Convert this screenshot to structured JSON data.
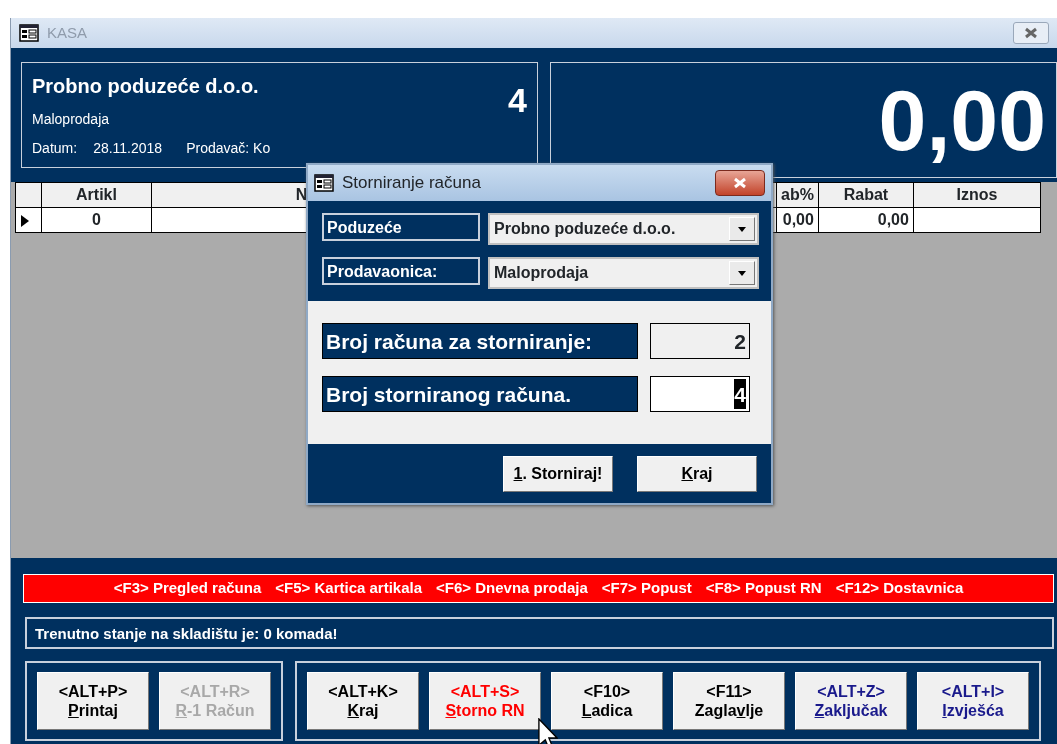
{
  "window": {
    "title": "KASA",
    "active": false
  },
  "header": {
    "company": "Probno poduzeće d.o.o.",
    "store": "Maloprodaja",
    "date_label": "Datum:",
    "date": "28.11.2018",
    "seller": "Prodavač: Ko",
    "receipt_number": "4",
    "total": "0,00"
  },
  "table": {
    "columns": [
      "Artikl",
      "N",
      "ab%",
      "Rabat",
      "Iznos"
    ],
    "rows": [
      {
        "current": true,
        "cells": [
          "0",
          null,
          "0,00",
          "0,00",
          null
        ]
      }
    ]
  },
  "function_keys": [
    "<F3> Pregled računa",
    "<F5> Kartica artikala",
    "<F6> Dnevna prodaja",
    "<F7> Popust",
    "<F8> Popust RN",
    "<F12> Dostavnica"
  ],
  "status": "Trenutno stanje na skladištu je: 0 komada!",
  "button_groups": [
    [
      {
        "hotkey": "<ALT+P>",
        "label": {
          "key": "P",
          "after": "rintaj"
        },
        "color": "#000000",
        "disabled": false
      },
      {
        "hotkey": "<ALT+R>",
        "label": {
          "key": "R",
          "after": "-1 Račun"
        },
        "disabled": true
      }
    ],
    [
      {
        "hotkey": "<ALT+K>",
        "label": {
          "key": "K",
          "after": "raj"
        },
        "color": "#000000",
        "disabled": false
      },
      {
        "hotkey": "<ALT+S>",
        "label": {
          "key": "S",
          "after": "torno RN"
        },
        "color": "#ff0000",
        "disabled": false
      },
      {
        "hotkey": "<F10>",
        "label": {
          "key": "L",
          "after": "adica"
        },
        "color": "#000000",
        "disabled": false
      },
      {
        "hotkey": "<F11>",
        "label": {
          "before": "Zagla",
          "key": "v",
          "after": "lje"
        },
        "color": "#000000",
        "disabled": false
      },
      {
        "hotkey": "<ALT+Z>",
        "label": {
          "key": "Z",
          "after": "aključak"
        },
        "color": "#1a1a8c",
        "disabled": false
      },
      {
        "hotkey": "<ALT+I>",
        "label": {
          "key": "I",
          "after": "zvješća"
        },
        "color": "#1a1a8c",
        "disabled": false
      }
    ]
  ],
  "dialog": {
    "title": "Storniranje računa",
    "selects": [
      {
        "label": "Poduzeće",
        "value": "Probno poduzeće d.o.o."
      },
      {
        "label": "Prodavaonica:",
        "value": "Maloprodaja"
      }
    ],
    "fields": [
      {
        "label": "Broj računa za storniranje:",
        "value": "2",
        "focused": false,
        "text_selected": false
      },
      {
        "label": "Broj storniranog računa.",
        "value": "4",
        "focused": true,
        "text_selected": true
      }
    ],
    "buttons": [
      {
        "label": {
          "key": "1",
          "after": ". Storniraj!"
        }
      },
      {
        "label": {
          "key": "K",
          "after": "raj"
        }
      }
    ]
  }
}
